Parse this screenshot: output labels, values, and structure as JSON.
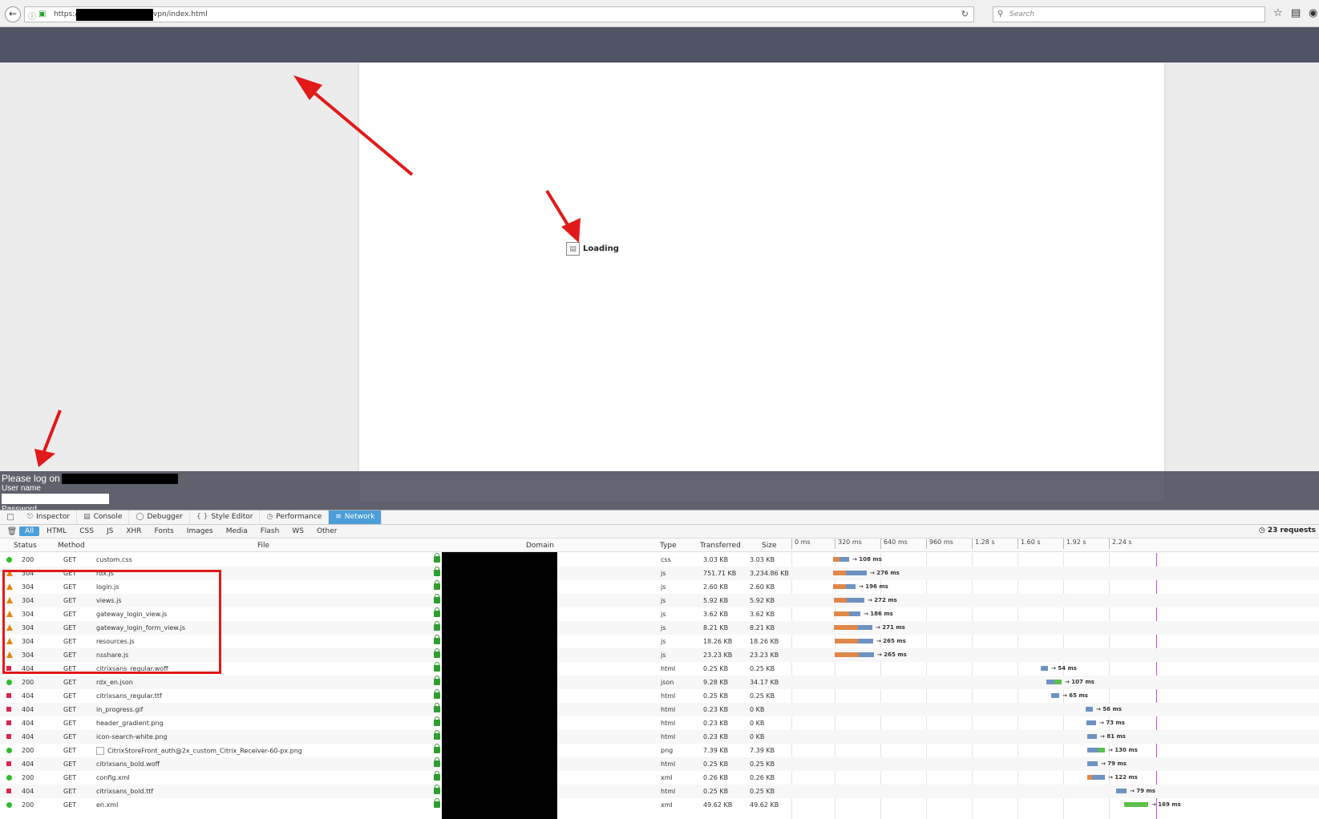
{
  "browser": {
    "url_prefix": "https://",
    "url_path": "vpn/index.html",
    "search_placeholder": "Search"
  },
  "page": {
    "loading_text": "Loading",
    "logon_title": "Please log on",
    "username_label": "User name",
    "password_label": "Password"
  },
  "devtools": {
    "tabs": [
      "Inspector",
      "Console",
      "Debugger",
      "Style Editor",
      "Performance",
      "Network"
    ],
    "active_tab": "Network",
    "filters": [
      "All",
      "HTML",
      "CSS",
      "JS",
      "XHR",
      "Fonts",
      "Images",
      "Media",
      "Flash",
      "WS",
      "Other"
    ],
    "active_filter": "All",
    "request_count": "23 requests",
    "columns": {
      "status": "Status",
      "method": "Method",
      "file": "File",
      "domain": "Domain",
      "type": "Type",
      "transferred": "Transferred",
      "size": "Size"
    },
    "timeline_ticks": [
      "0 ms",
      "320 ms",
      "640 ms",
      "960 ms",
      "1.28 s",
      "1.60 s",
      "1.92 s",
      "2.24 s"
    ],
    "requests": [
      {
        "status": "200",
        "method": "GET",
        "file": "custom.css",
        "type": "css",
        "transferred": "3.03 KB",
        "size": "3.03 KB",
        "time": "→ 108 ms",
        "state": "ok"
      },
      {
        "status": "304",
        "method": "GET",
        "file": "rdx.js",
        "type": "js",
        "transferred": "751.71 KB",
        "size": "3,234.86 KB",
        "time": "→ 276 ms",
        "state": "cached"
      },
      {
        "status": "304",
        "method": "GET",
        "file": "login.js",
        "type": "js",
        "transferred": "2.60 KB",
        "size": "2.60 KB",
        "time": "→ 196 ms",
        "state": "cached"
      },
      {
        "status": "304",
        "method": "GET",
        "file": "views.js",
        "type": "js",
        "transferred": "5.92 KB",
        "size": "5.92 KB",
        "time": "→ 272 ms",
        "state": "cached"
      },
      {
        "status": "304",
        "method": "GET",
        "file": "gateway_login_view.js",
        "type": "js",
        "transferred": "3.62 KB",
        "size": "3.62 KB",
        "time": "→ 186 ms",
        "state": "cached"
      },
      {
        "status": "304",
        "method": "GET",
        "file": "gateway_login_form_view.js",
        "type": "js",
        "transferred": "8.21 KB",
        "size": "8.21 KB",
        "time": "→ 271 ms",
        "state": "cached"
      },
      {
        "status": "304",
        "method": "GET",
        "file": "resources.js",
        "type": "js",
        "transferred": "18.26 KB",
        "size": "18.26 KB",
        "time": "→ 265 ms",
        "state": "cached"
      },
      {
        "status": "304",
        "method": "GET",
        "file": "nsshare.js",
        "type": "js",
        "transferred": "23.23 KB",
        "size": "23.23 KB",
        "time": "→ 265 ms",
        "state": "cached"
      },
      {
        "status": "404",
        "method": "GET",
        "file": "citrixsans_regular.woff",
        "type": "html",
        "transferred": "0.25 KB",
        "size": "0.25 KB",
        "time": "→ 54 ms",
        "state": "error"
      },
      {
        "status": "200",
        "method": "GET",
        "file": "rdx_en.json",
        "type": "json",
        "transferred": "9.28 KB",
        "size": "34.17 KB",
        "time": "→ 107 ms",
        "state": "ok"
      },
      {
        "status": "404",
        "method": "GET",
        "file": "citrixsans_regular.ttf",
        "type": "html",
        "transferred": "0.25 KB",
        "size": "0.25 KB",
        "time": "→ 65 ms",
        "state": "error"
      },
      {
        "status": "404",
        "method": "GET",
        "file": "in_progress.gif",
        "type": "html",
        "transferred": "0.23 KB",
        "size": "0 KB",
        "time": "→ 56 ms",
        "state": "error"
      },
      {
        "status": "404",
        "method": "GET",
        "file": "header_gradient.png",
        "type": "html",
        "transferred": "0.23 KB",
        "size": "0 KB",
        "time": "→ 73 ms",
        "state": "error"
      },
      {
        "status": "404",
        "method": "GET",
        "file": "icon-search-white.png",
        "type": "html",
        "transferred": "0.23 KB",
        "size": "0 KB",
        "time": "→ 81 ms",
        "state": "error"
      },
      {
        "status": "200",
        "method": "GET",
        "file": "CitrixStoreFront_auth@2x_custom_Citrix_Receiver-60-px.png",
        "type": "png",
        "transferred": "7.39 KB",
        "size": "7.39 KB",
        "time": "→ 130 ms",
        "state": "ok"
      },
      {
        "status": "404",
        "method": "GET",
        "file": "citrixsans_bold.woff",
        "type": "html",
        "transferred": "0.25 KB",
        "size": "0.25 KB",
        "time": "→ 79 ms",
        "state": "error"
      },
      {
        "status": "200",
        "method": "GET",
        "file": "config.xml",
        "type": "xml",
        "transferred": "0.26 KB",
        "size": "0.26 KB",
        "time": "→ 122 ms",
        "state": "ok"
      },
      {
        "status": "404",
        "method": "GET",
        "file": "citrixsans_bold.ttf",
        "type": "html",
        "transferred": "0.25 KB",
        "size": "0.25 KB",
        "time": "→ 79 ms",
        "state": "error"
      },
      {
        "status": "200",
        "method": "GET",
        "file": "en.xml",
        "type": "xml",
        "transferred": "49.62 KB",
        "size": "49.62 KB",
        "time": "→ 169 ms",
        "state": "ok"
      }
    ]
  },
  "colors": {
    "header_band": "#4f5565",
    "annotation_red": "#e11a1a",
    "devtools_active": "#4c9ed9",
    "status_ok": "#2cbb2c",
    "status_cached": "#e8840a",
    "status_error": "#d7264f"
  }
}
